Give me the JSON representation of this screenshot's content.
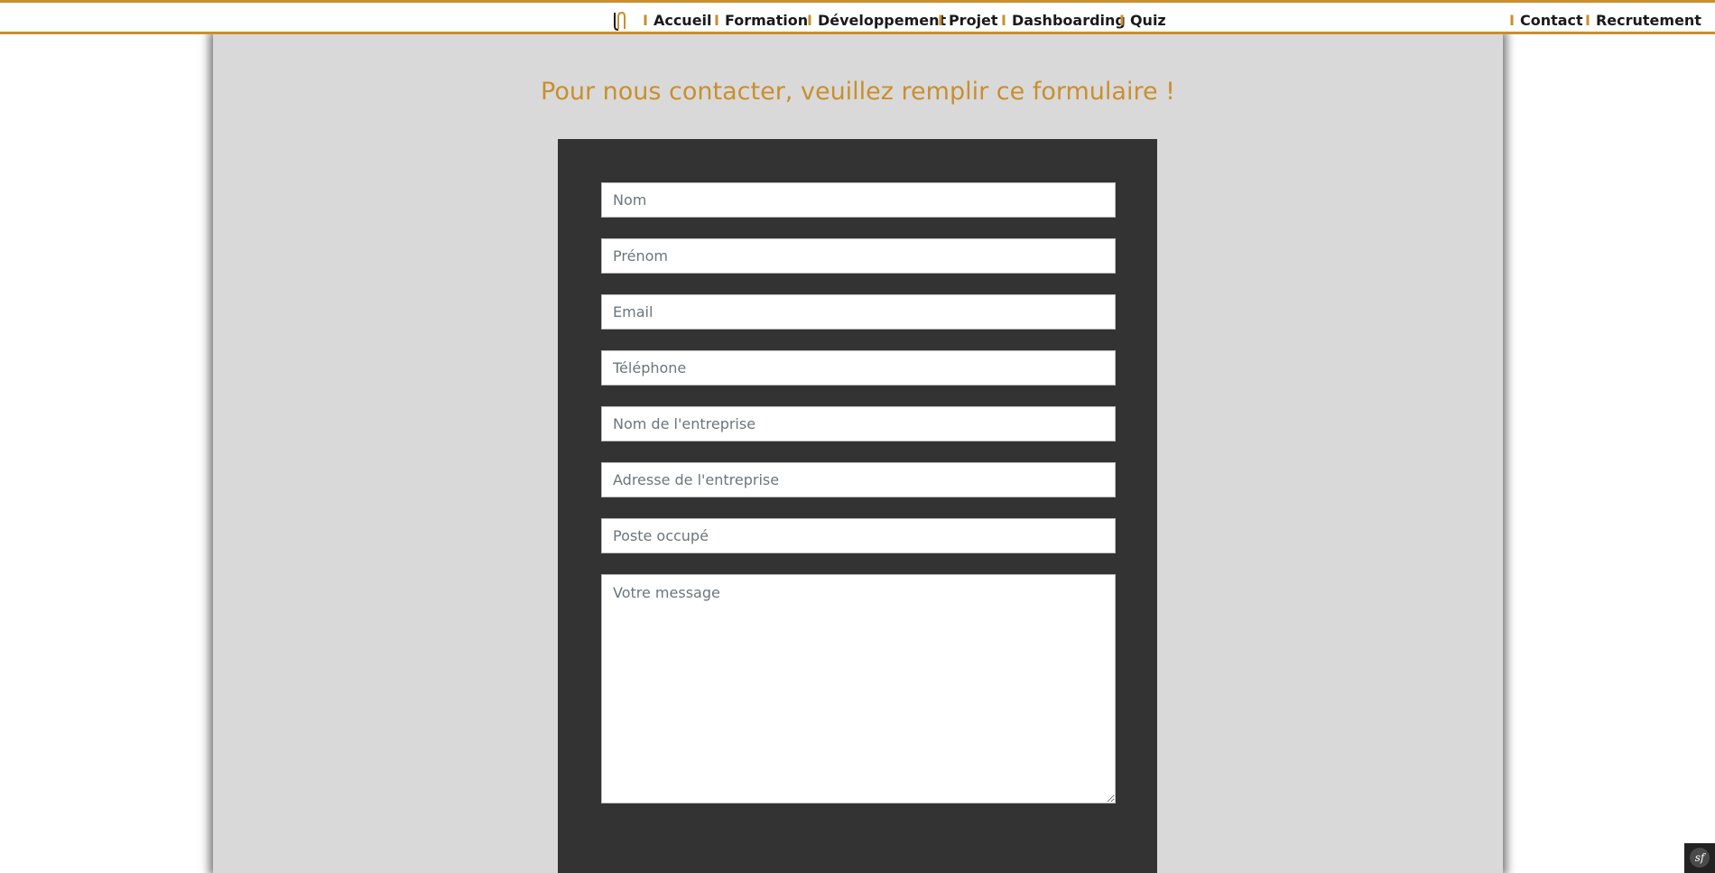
{
  "nav": {
    "logo_icon": "brand-logo-icon",
    "separator": "I",
    "items": [
      {
        "label": "Accueil"
      },
      {
        "label": "Formation"
      },
      {
        "label": "Développement"
      },
      {
        "label": "Projet"
      },
      {
        "label": "Dashboarding"
      },
      {
        "label": "Quiz"
      }
    ],
    "right_items": [
      {
        "label": "Contact"
      },
      {
        "label": "Recrutement"
      }
    ]
  },
  "page": {
    "title": "Pour nous contacter, veuillez remplir ce formulaire !"
  },
  "form": {
    "fields": {
      "nom": {
        "placeholder": "Nom",
        "value": ""
      },
      "prenom": {
        "placeholder": "Prénom",
        "value": ""
      },
      "email": {
        "placeholder": "Email",
        "value": ""
      },
      "telephone": {
        "placeholder": "Téléphone",
        "value": ""
      },
      "entreprise_nom": {
        "placeholder": "Nom de l'entreprise",
        "value": ""
      },
      "entreprise_adresse": {
        "placeholder": "Adresse de l'entreprise",
        "value": ""
      },
      "poste": {
        "placeholder": "Poste occupé",
        "value": ""
      },
      "message": {
        "placeholder": "Votre message",
        "value": ""
      }
    }
  },
  "debug_toolbar": {
    "icon": "symfony-icon",
    "label": "sf"
  },
  "colors": {
    "accent": "#c98f2e",
    "panel_bg": "#d9d9d9",
    "form_bg": "#333333"
  }
}
